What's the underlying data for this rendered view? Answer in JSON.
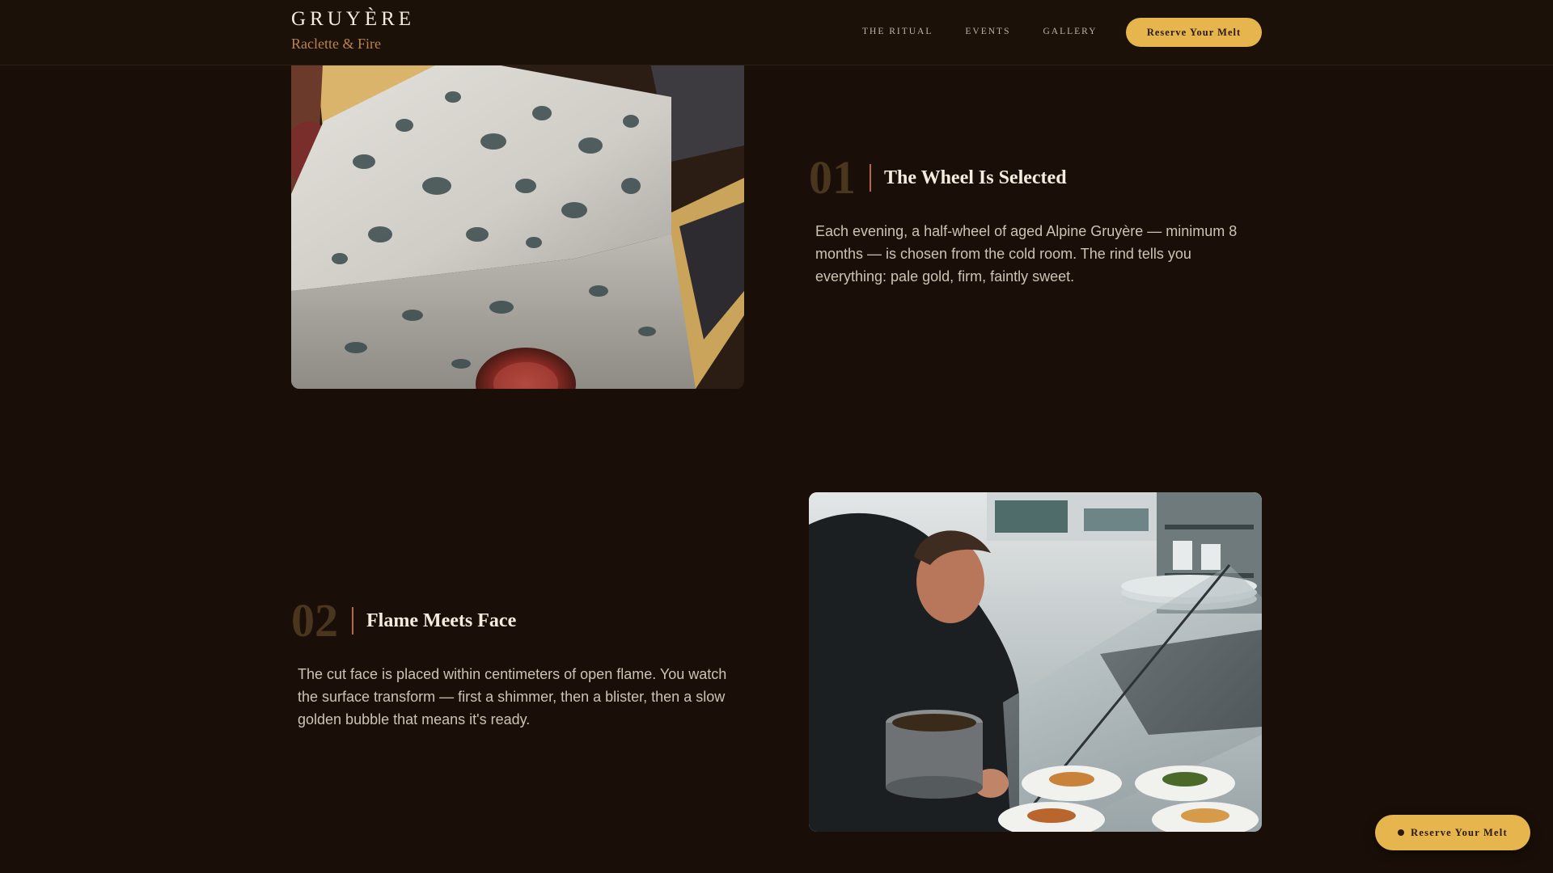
{
  "header": {
    "brand_name": "GRUYÈRE",
    "tagline": "Raclette & Fire",
    "nav": [
      "THE RITUAL",
      "EVENTS",
      "GALLERY"
    ],
    "cta_label": "Reserve Your Melt"
  },
  "steps": [
    {
      "number": "01",
      "title": "The Wheel Is Selected",
      "body": "Each evening, a half-wheel of aged Alpine Gruyère — minimum 8 months — is chosen from the cold room. The rind tells you everything: pale gold, firm, faintly sweet."
    },
    {
      "number": "02",
      "title": "Flame Meets Face",
      "body": "The cut face is placed within centimeters of open flame. You watch the surface transform — first a shimmer, then a blister, then a slow golden bubble that means it's ready."
    }
  ],
  "floating_cta": {
    "label": "Reserve Your Melt",
    "icon": "dot-icon"
  },
  "images": {
    "step_1": "blue-cheese-wedge-photo",
    "step_2": "chef-cooking-photo"
  },
  "colors": {
    "background": "#1a0f08",
    "accent": "#e7b54e",
    "tagline": "#b98350",
    "step_rule": "#b8683c",
    "step_number": "#4a361e"
  }
}
